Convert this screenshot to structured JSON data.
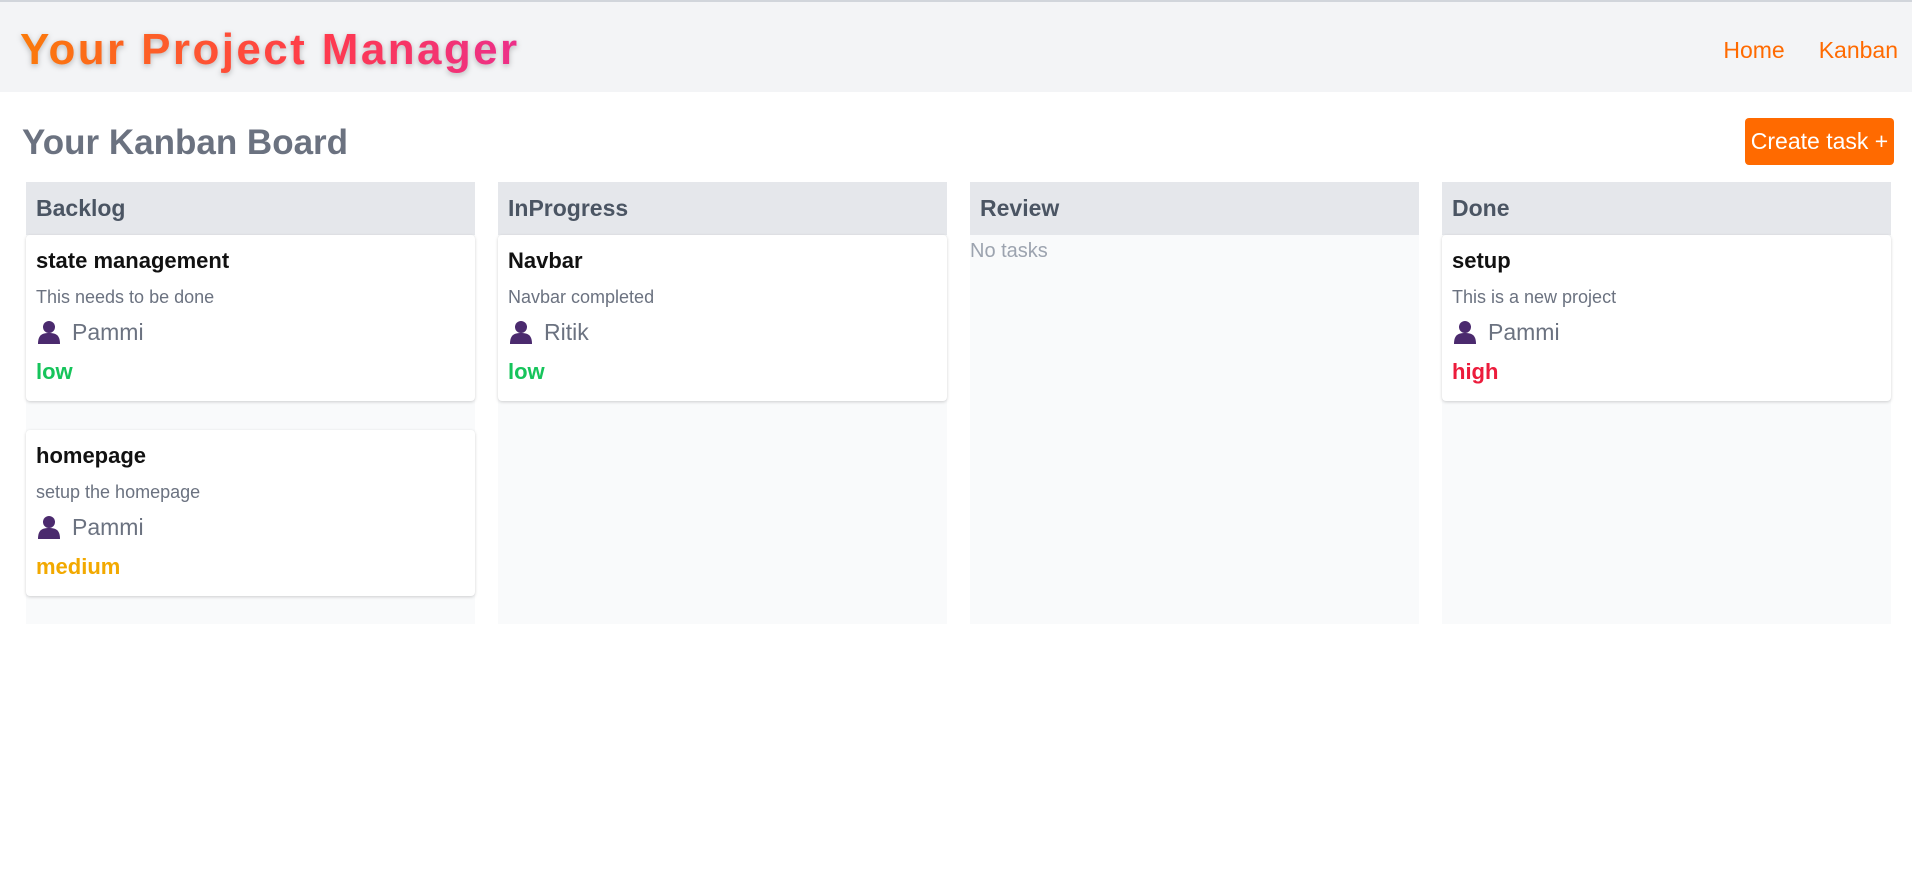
{
  "app": {
    "title": "Your Project Manager",
    "nav": [
      {
        "label": "Home"
      },
      {
        "label": "Kanban"
      }
    ]
  },
  "board": {
    "title": "Your Kanban Board",
    "create_label": "Create task +",
    "empty_text": "No tasks",
    "columns": [
      {
        "name": "Backlog",
        "tasks": [
          {
            "title": "state management",
            "description": "This needs to be done",
            "assignee": "Pammi",
            "priority": "low"
          },
          {
            "title": "homepage",
            "description": "setup the homepage",
            "assignee": "Pammi",
            "priority": "medium"
          }
        ]
      },
      {
        "name": "InProgress",
        "tasks": [
          {
            "title": "Navbar",
            "description": "Navbar completed",
            "assignee": "Ritik",
            "priority": "low"
          }
        ]
      },
      {
        "name": "Review",
        "tasks": []
      },
      {
        "name": "Done",
        "tasks": [
          {
            "title": "setup",
            "description": "This is a new project",
            "assignee": "Pammi",
            "priority": "high"
          }
        ]
      }
    ]
  },
  "colors": {
    "accent": "#ff6a00",
    "priority_low": "#16c45b",
    "priority_medium": "#f2a900",
    "priority_high": "#ec1c3c",
    "user_icon": "#4b2a6e"
  },
  "icons": {
    "user": "user-icon"
  }
}
